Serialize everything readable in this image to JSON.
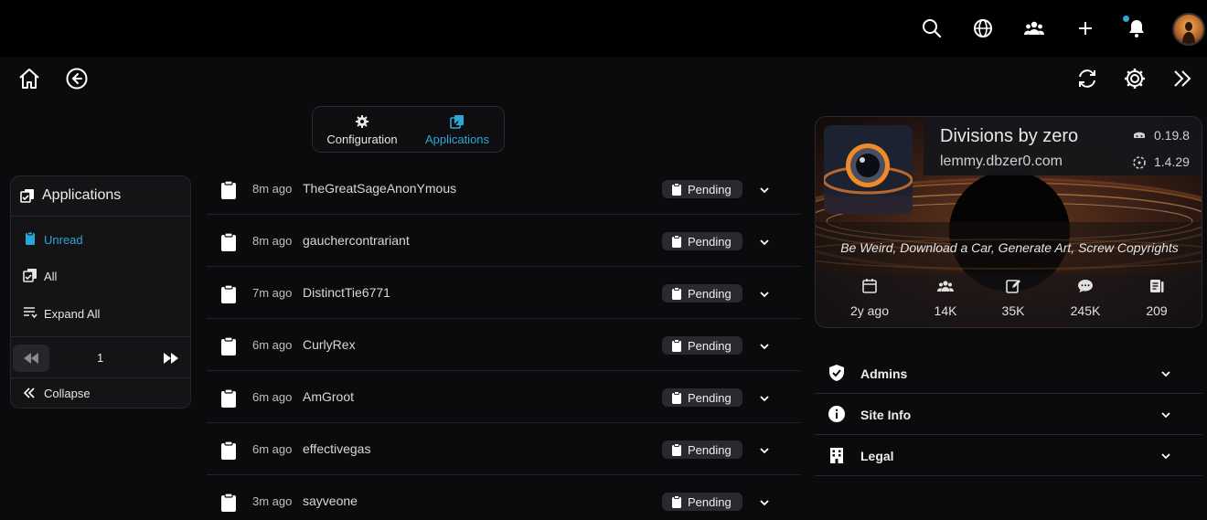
{
  "colors": {
    "accent": "#2aa7d8",
    "background": "#0b0b0d",
    "topbar": "#000000"
  },
  "topbar": {
    "icons": [
      "search-icon",
      "globe-icon",
      "communities-icon",
      "plus-icon",
      "bell-icon",
      "avatar"
    ]
  },
  "nav": {
    "icons": [
      "home-icon",
      "back-icon",
      "refresh-icon",
      "gear-icon",
      "chevrons-right-icon"
    ]
  },
  "tabs": [
    {
      "label": "Configuration",
      "icon": "gear-icon"
    },
    {
      "label": "Applications",
      "icon": "applications-icon",
      "active": true
    }
  ],
  "sidebar": {
    "title": "Applications",
    "items": [
      {
        "label": "Unread",
        "icon": "clipboard-icon",
        "active": true
      },
      {
        "label": "All",
        "icon": "applications-icon"
      },
      {
        "label": "Expand All",
        "icon": "expand-all-icon"
      }
    ],
    "page": "1",
    "collapse_label": "Collapse"
  },
  "applications": [
    {
      "time": "8m ago",
      "user": "TheGreatSageAnonYmous",
      "status": "Pending"
    },
    {
      "time": "8m ago",
      "user": "gauchercontrariant",
      "status": "Pending"
    },
    {
      "time": "7m ago",
      "user": "DistinctTie6771",
      "status": "Pending"
    },
    {
      "time": "6m ago",
      "user": "CurlyRex",
      "status": "Pending"
    },
    {
      "time": "6m ago",
      "user": "AmGroot",
      "status": "Pending"
    },
    {
      "time": "6m ago",
      "user": "effectivegas",
      "status": "Pending"
    },
    {
      "time": "3m ago",
      "user": "sayveone",
      "status": "Pending"
    }
  ],
  "site": {
    "name": "Divisions by zero",
    "host": "lemmy.dbzer0.com",
    "version_backend": "0.19.8",
    "version_ui": "1.4.29",
    "tagline": "Be Weird, Download a Car, Generate Art, Screw Copyrights",
    "stats": [
      {
        "icon": "calendar-icon",
        "value": "2y ago"
      },
      {
        "icon": "users-icon",
        "value": "14K"
      },
      {
        "icon": "posts-icon",
        "value": "35K"
      },
      {
        "icon": "comments-icon",
        "value": "245K"
      },
      {
        "icon": "communities-icon",
        "value": "209"
      }
    ]
  },
  "accordions": [
    {
      "label": "Admins",
      "icon": "shield-check-icon"
    },
    {
      "label": "Site Info",
      "icon": "info-icon"
    },
    {
      "label": "Legal",
      "icon": "building-icon"
    }
  ]
}
